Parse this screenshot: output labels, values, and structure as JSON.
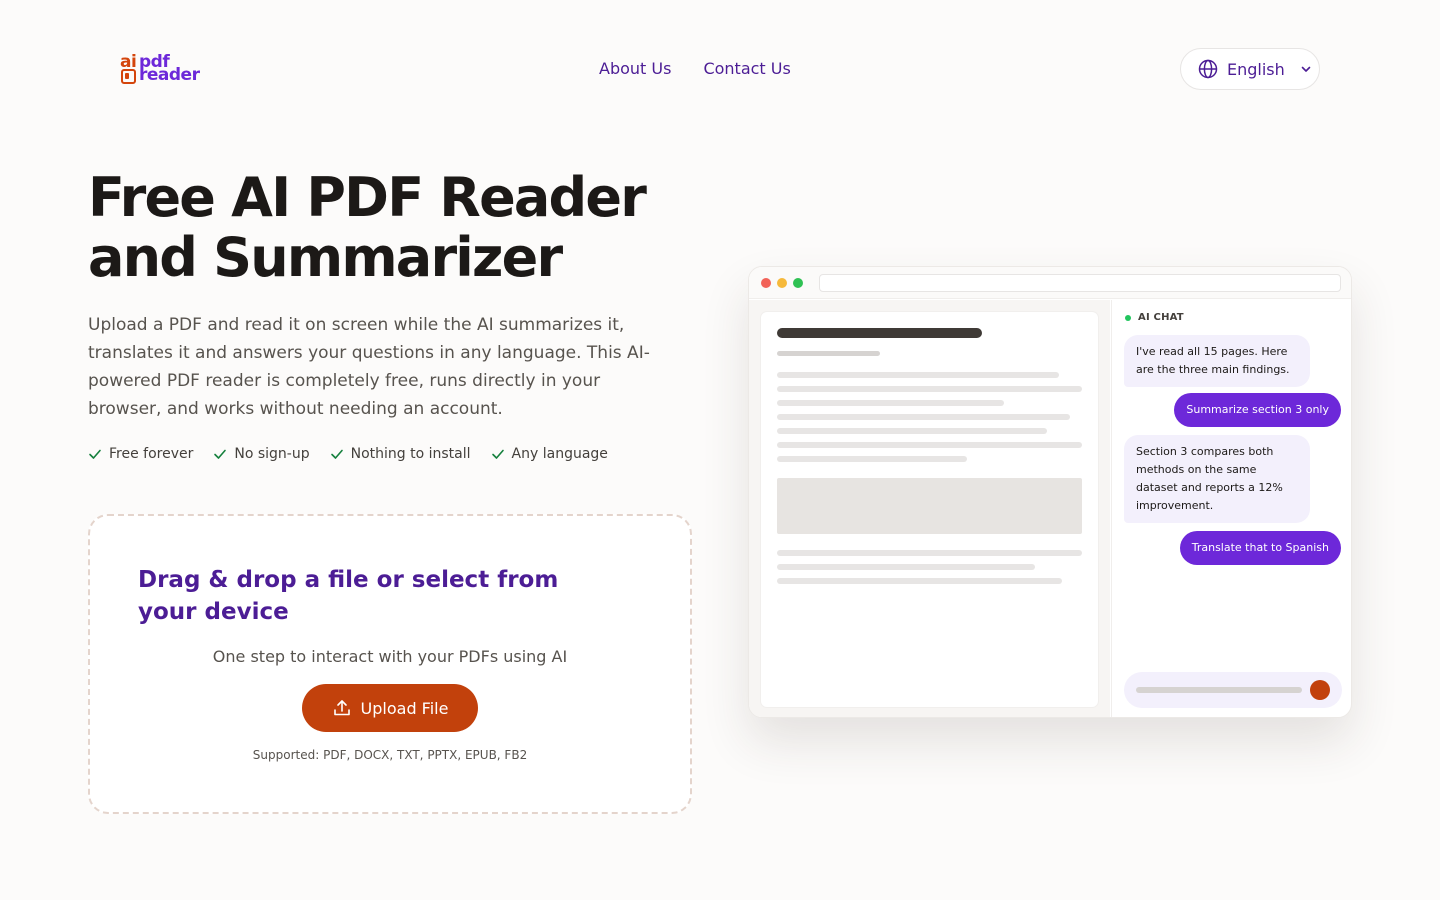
{
  "brand": {
    "logo_ai": "ai",
    "logo_pdf": "pdf",
    "logo_reader": "reader"
  },
  "nav": {
    "items": [
      {
        "label": "About Us"
      },
      {
        "label": "Contact Us"
      }
    ]
  },
  "language": {
    "selected": "English"
  },
  "hero": {
    "title": "Free AI PDF Reader and Summarizer",
    "subtitle": "Upload a PDF and read it on screen while the AI summarizes it, translates it and answers your questions in any language. This AI-powered PDF reader is completely free, runs directly in your browser, and works without needing an account.",
    "checks": [
      {
        "label": "Free forever"
      },
      {
        "label": "No sign-up"
      },
      {
        "label": "Nothing to install"
      },
      {
        "label": "Any language"
      }
    ]
  },
  "upload": {
    "title": "Drag & drop a file or select from your device",
    "description": "One step to interact with your PDFs using AI",
    "button_label": "Upload File",
    "supported": "Supported: PDF, DOCX, TXT, PPTX, EPUB, FB2"
  },
  "mock_chat": {
    "label": "AI CHAT",
    "messages": [
      {
        "role": "ai",
        "text": "I've read all 15 pages. Here are the three main findings."
      },
      {
        "role": "user",
        "text": "Summarize section 3 only"
      },
      {
        "role": "ai",
        "text": "Section 3 compares both methods on the same dataset and reports a 12% improvement."
      },
      {
        "role": "user",
        "text": "Translate that to Spanish"
      }
    ]
  },
  "colors": {
    "brand_purple": "#6d28d9",
    "brand_orange": "#c2410c",
    "nav_text": "#4c1d95",
    "live_dot": "#22c55e"
  }
}
